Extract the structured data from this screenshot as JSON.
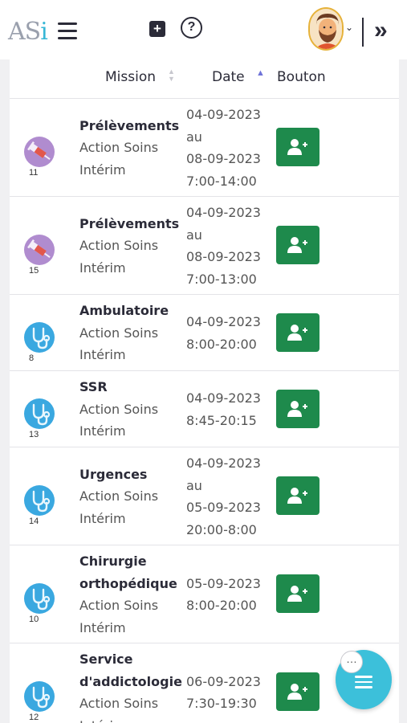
{
  "header": {
    "logo_text": "AS",
    "logo_accent": "i",
    "plus_glyph": "+",
    "help_glyph": "?",
    "chevron_glyph": "⌄",
    "collapse_glyph": "»"
  },
  "table": {
    "columns": {
      "mission": "Mission",
      "date": "Date",
      "bouton": "Bouton"
    },
    "rows": [
      {
        "num": "11",
        "icon": "syringe-icon",
        "title": [
          "Prélèvements"
        ],
        "company": "Action Soins",
        "type": "Intérim",
        "dates": [
          "04-09-2023",
          "au",
          "08-09-2023",
          "7:00-14:00"
        ]
      },
      {
        "num": "15",
        "icon": "syringe-icon",
        "title": [
          "Prélèvements"
        ],
        "company": "Action Soins",
        "type": "Intérim",
        "dates": [
          "04-09-2023",
          "au",
          "08-09-2023",
          "7:00-13:00"
        ]
      },
      {
        "num": "8",
        "icon": "stethoscope-icon",
        "title": [
          "Ambulatoire"
        ],
        "company": "Action Soins",
        "type": "Intérim",
        "dates": [
          "04-09-2023",
          "8:00-20:00"
        ]
      },
      {
        "num": "13",
        "icon": "stethoscope-icon",
        "title": [
          "SSR"
        ],
        "company": "Action Soins",
        "type": "Intérim",
        "dates": [
          "04-09-2023",
          "8:45-20:15"
        ]
      },
      {
        "num": "14",
        "icon": "stethoscope-icon",
        "title": [
          "Urgences"
        ],
        "company": "Action Soins",
        "type": "Intérim",
        "dates": [
          "04-09-2023",
          "au",
          "05-09-2023",
          "20:00-8:00"
        ]
      },
      {
        "num": "10",
        "icon": "stethoscope-icon",
        "title": [
          "Chirurgie",
          "orthopédique"
        ],
        "company": "Action Soins",
        "type": "Intérim",
        "dates": [
          "05-09-2023",
          "8:00-20:00"
        ]
      },
      {
        "num": "12",
        "icon": "stethoscope-icon",
        "title": [
          "Service",
          "d'addictologie"
        ],
        "company": "Action Soins",
        "type": "Intérim",
        "dates": [
          "06-09-2023",
          "7:30-19:30"
        ]
      }
    ]
  },
  "fab": {
    "dots_glyph": "…"
  },
  "colors": {
    "accent": "#3cc0da",
    "button_green": "#1e8a4c",
    "syringe_bg": "#b08ccf",
    "stethoscope_bg": "#3aa8e0",
    "sort_active": "#6f73d8"
  }
}
